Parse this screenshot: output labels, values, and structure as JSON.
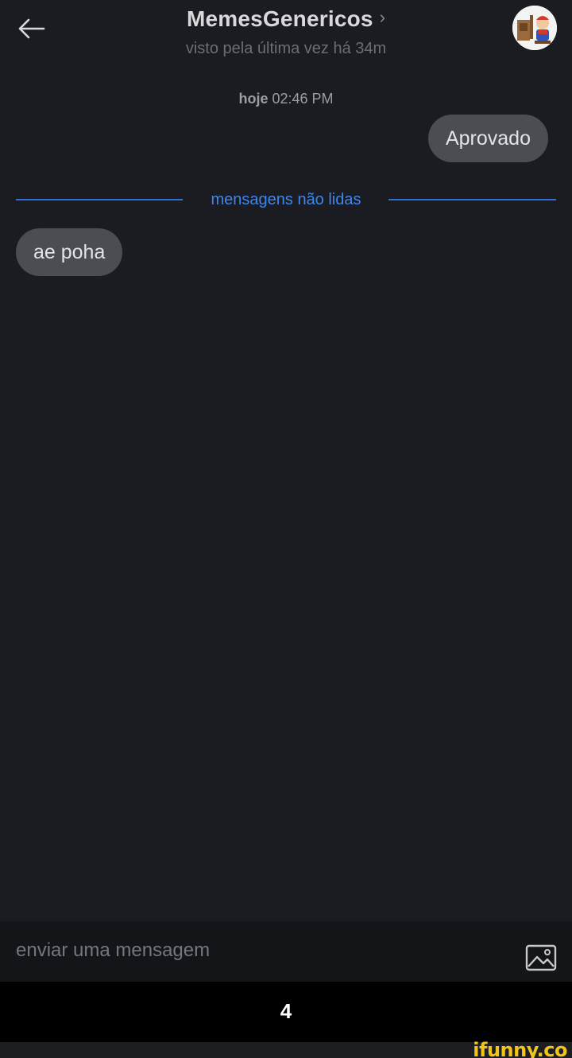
{
  "header": {
    "title": "MemesGenericos",
    "chevron": "›",
    "subtitle": "visto pela última vez há 34m",
    "back_icon": "back-arrow-icon",
    "avatar_icon": "profile-avatar"
  },
  "conversation": {
    "date_bold": "hoje",
    "date_time": "02:46 PM",
    "messages": [
      {
        "direction": "outgoing",
        "text": "Aprovado"
      },
      {
        "direction": "incoming",
        "text": "ae poha"
      }
    ],
    "unread_label": "mensagens não lidas"
  },
  "composer": {
    "placeholder": "enviar uma mensagem",
    "value": "",
    "image_icon": "image-icon"
  },
  "caption": {
    "number": "4"
  },
  "watermark": {
    "text": "ifunny.co"
  },
  "colors": {
    "background": "#1b1c22",
    "bubble": "#4c4d52",
    "accent_blue": "#3d86ee",
    "watermark": "#f2c418"
  }
}
